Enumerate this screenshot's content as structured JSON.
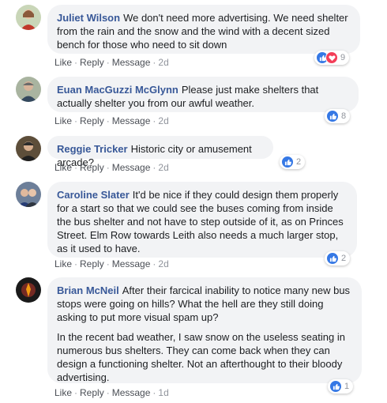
{
  "actions": {
    "like": "Like",
    "reply": "Reply",
    "message": "Message",
    "separator": "·"
  },
  "colors": {
    "author": "#385898",
    "bubble": "#f2f3f5",
    "like": "#3578e5",
    "love": "#f33e58"
  },
  "comments": [
    {
      "author": "Juliet Wilson",
      "paragraphs": [
        "We don't need more advertising. We need shelter from the rain and the snow and the wind with a decent sized bench for those who need to sit down"
      ],
      "time": "2d",
      "reaction_icons": [
        "like-icon",
        "love-icon"
      ],
      "reaction_count": "9"
    },
    {
      "author": "Euan MacGuzzi McGlynn",
      "paragraphs": [
        "Please just make shelters that actually shelter you from our awful weather."
      ],
      "time": "2d",
      "reaction_icons": [
        "like-icon"
      ],
      "reaction_count": "8"
    },
    {
      "author": "Reggie Tricker",
      "paragraphs": [
        "Historic city or amusement arcade?"
      ],
      "time": "2d",
      "reaction_icons": [
        "like-icon"
      ],
      "reaction_count": "2"
    },
    {
      "author": "Caroline Slater",
      "paragraphs": [
        "It'd be nice if they could design them properly for a start so that we could see the buses coming from inside the bus shelter and not have to step outside of it, as on Princes Street. Elm Row towards Leith also needs a much larger stop, as it used to have."
      ],
      "time": "2d",
      "reaction_icons": [
        "like-icon"
      ],
      "reaction_count": "2"
    },
    {
      "author": "Brian McNeil",
      "paragraphs": [
        "After their farcical inability to notice many new bus stops were going on hills? What the hell are they still doing asking to put more visual spam up?",
        "In the recent bad weather, I saw snow on the useless seating in numerous bus shelters. They can come back when they can design a functioning shelter. Not an afterthought to their bloody advertising."
      ],
      "time": "1d",
      "reaction_icons": [
        "like-icon"
      ],
      "reaction_count": "1"
    }
  ]
}
